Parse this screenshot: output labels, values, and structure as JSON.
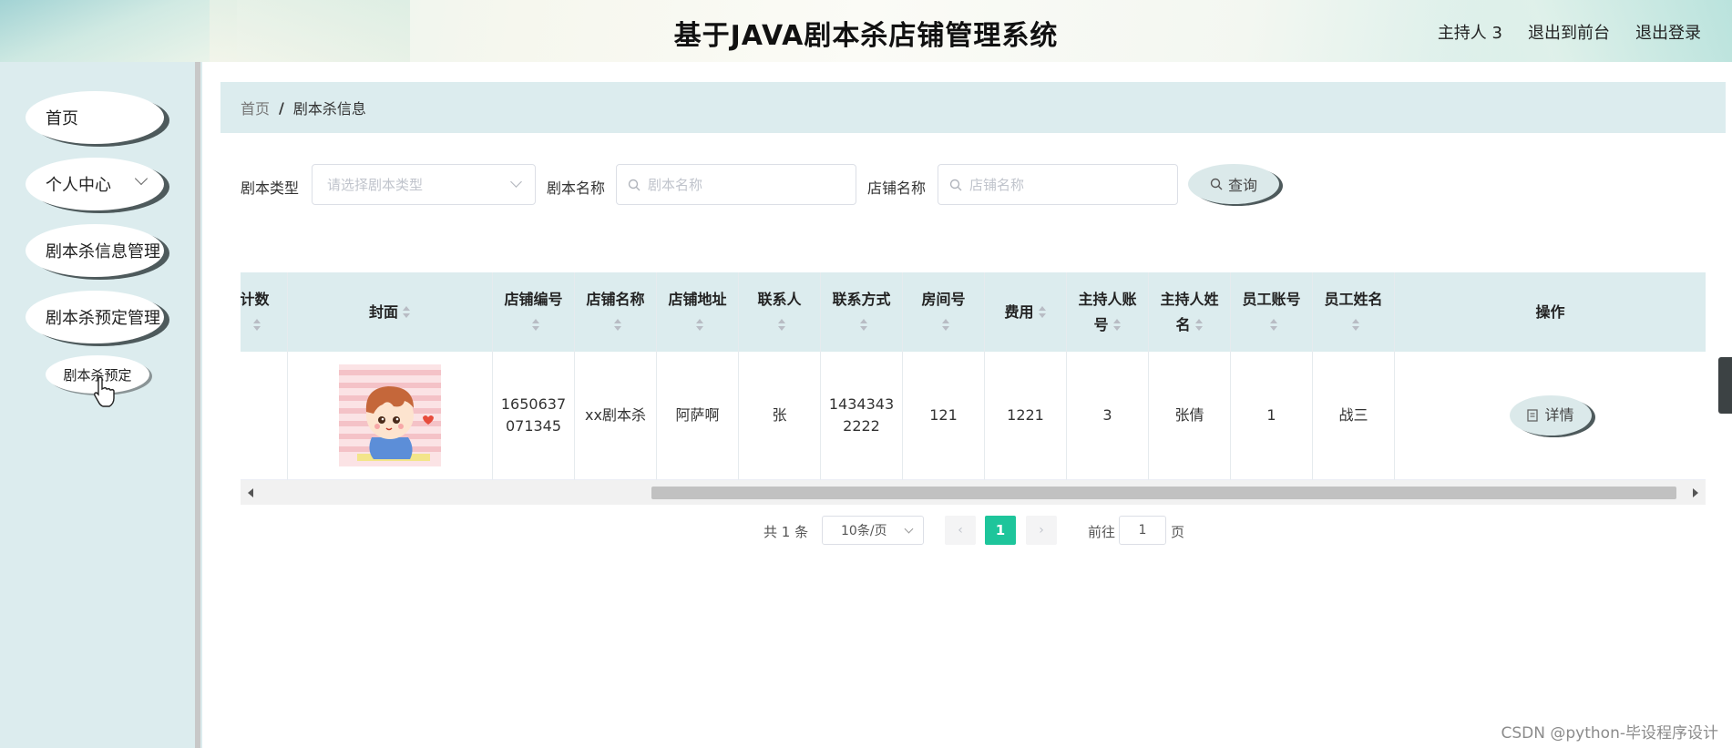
{
  "header": {
    "title": "基于JAVA剧本杀店铺管理系统",
    "user": "主持人 3",
    "to_front": "退出到前台",
    "logout": "退出登录"
  },
  "sidebar": {
    "items": [
      {
        "label": "首页"
      },
      {
        "label": "个人中心"
      },
      {
        "label": "剧本杀信息管理"
      },
      {
        "label": "剧本杀预定管理"
      }
    ],
    "sub_item": "剧本杀预定"
  },
  "breadcrumb": {
    "home": "首页",
    "separator": "/",
    "current": "剧本杀信息"
  },
  "search": {
    "type_label": "剧本类型",
    "type_placeholder": "请选择剧本类型",
    "name_label": "剧本名称",
    "name_placeholder": "剧本名称",
    "shop_label": "店铺名称",
    "shop_placeholder": "店铺名称",
    "query_button": "查询"
  },
  "table": {
    "columns": [
      {
        "label": "计数",
        "line2": ""
      },
      {
        "label": "封面",
        "line2": ""
      },
      {
        "label": "店铺编号",
        "line2": ""
      },
      {
        "label": "店铺名称",
        "line2": ""
      },
      {
        "label": "店铺地址",
        "line2": ""
      },
      {
        "label": "联系人",
        "line2": ""
      },
      {
        "label": "联系方式",
        "line2": ""
      },
      {
        "label": "房间号",
        "line2": ""
      },
      {
        "label": "费用",
        "line2": ""
      },
      {
        "label": "主持人账",
        "line2": "号"
      },
      {
        "label": "主持人姓",
        "line2": "名"
      },
      {
        "label": "员工账号",
        "line2": ""
      },
      {
        "label": "员工姓名",
        "line2": ""
      },
      {
        "label": "操作",
        "line2": ""
      }
    ],
    "row": {
      "count": "",
      "shop_no_1": "1650637",
      "shop_no_2": "071345",
      "shop_name": "xx剧本杀",
      "address": "阿萨啊",
      "contact": "张",
      "phone_1": "1434343",
      "phone_2": "2222",
      "room": "121",
      "fee": "1221",
      "host_account": "3",
      "host_name": "张倩",
      "staff_account": "1",
      "staff_name": "战三",
      "action": "详情"
    }
  },
  "pagination": {
    "total": "共 1 条",
    "page_size": "10条/页",
    "current_page": "1",
    "goto_label": "前往",
    "goto_value": "1",
    "page_suffix": "页"
  },
  "watermark": "CSDN @python-毕设程序设计",
  "colors": {
    "accent": "#1ec59b",
    "panel": "#dcecee"
  }
}
